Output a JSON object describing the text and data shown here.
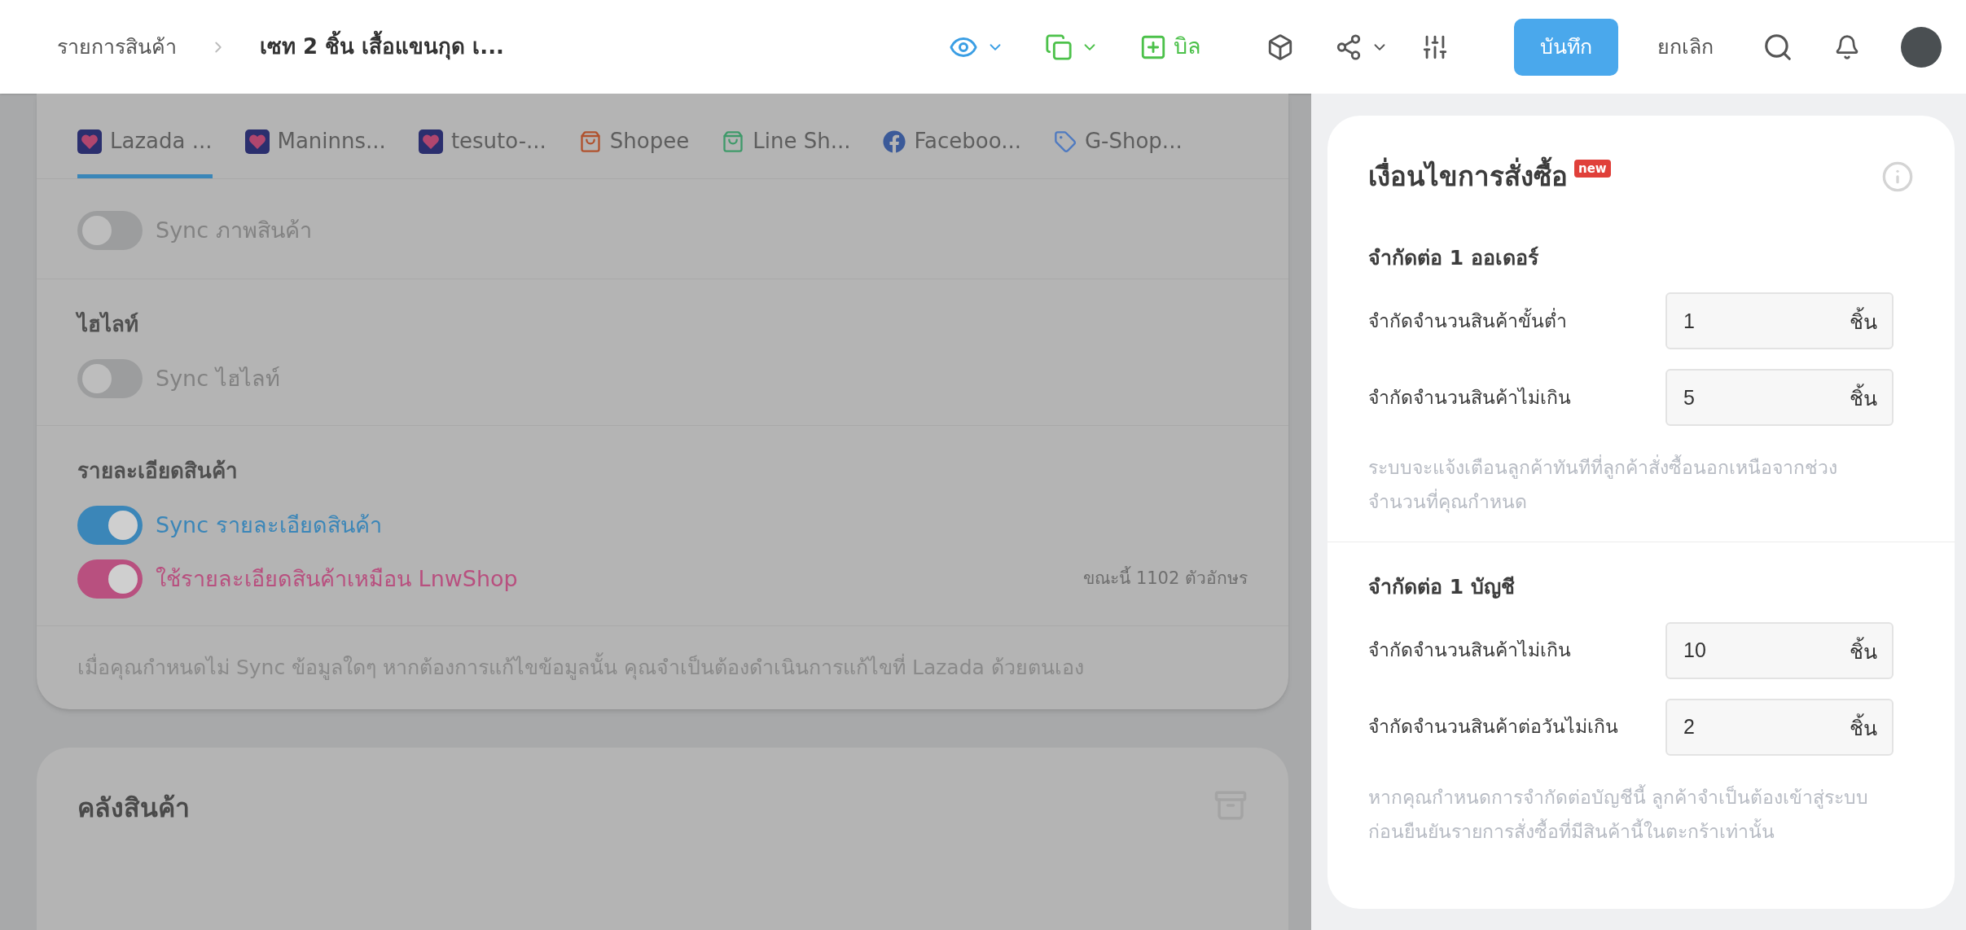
{
  "breadcrumb": {
    "parent": "รายการสินค้า",
    "current": "เซท 2 ชิ้น เสื้อแขนกุด เ..."
  },
  "toolbar": {
    "bill_label": "บิล",
    "save": "บันทึก",
    "cancel": "ยกเลิก"
  },
  "channel_tabs": [
    {
      "kind": "lazada",
      "label": "Lazada ...",
      "selected": true
    },
    {
      "kind": "lazada",
      "label": "Maninns...",
      "selected": false
    },
    {
      "kind": "lazada",
      "label": "tesuto-...",
      "selected": false
    },
    {
      "kind": "shopee",
      "label": "Shopee",
      "selected": false
    },
    {
      "kind": "line",
      "label": "Line Sh...",
      "selected": false
    },
    {
      "kind": "facebook",
      "label": "Faceboo...",
      "selected": false
    },
    {
      "kind": "gshop",
      "label": "G-Shop...",
      "selected": false
    }
  ],
  "sync_sections": [
    {
      "toggles": [
        {
          "label": "Sync ภาพสินค้า",
          "on": false
        }
      ]
    },
    {
      "heading": "ไฮไลท์",
      "toggles": [
        {
          "label": "Sync ไฮไลท์",
          "on": false
        }
      ]
    },
    {
      "heading": "รายละเอียดสินค้า",
      "toggles": [
        {
          "label": "Sync รายละเอียดสินค้า",
          "on": true,
          "color": "#3b86b8"
        },
        {
          "label": "ใช้รายละเอียดสินค้าเหมือน LnwShop",
          "on": true,
          "color": "#b8507f",
          "note": "ขณะนี้ 1102 ตัวอักษร"
        }
      ]
    }
  ],
  "sync_footnote": "เมื่อคุณกำหนดไม่ Sync ข้อมูลใดๆ หากต้องการแก้ไขข้อมูลนั้น คุณจำเป็นต้องดำเนินการแก้ไขที่ Lazada ด้วยตนเอง",
  "warehouse": {
    "title": "คลังสินค้า"
  },
  "order_conditions": {
    "title": "เงื่อนไขการสั่งซื้อ",
    "badge": "new",
    "groups": [
      {
        "heading": "จำกัดต่อ 1 ออเดอร์",
        "fields": [
          {
            "label": "จำกัดจำนวนสินค้าขั้นต่ำ",
            "value": "1",
            "unit": "ชิ้น"
          },
          {
            "label": "จำกัดจำนวนสินค้าไม่เกิน",
            "value": "5",
            "unit": "ชิ้น"
          }
        ],
        "note": "ระบบจะแจ้งเตือนลูกค้าทันทีที่ลูกค้าสั่งซื้อนอกเหนือจากช่วงจำนวนที่คุณกำหนด"
      },
      {
        "heading": "จำกัดต่อ 1 บัญชี",
        "fields": [
          {
            "label": "จำกัดจำนวนสินค้าไม่เกิน",
            "value": "10",
            "unit": "ชิ้น"
          },
          {
            "label": "จำกัดจำนวนสินค้าต่อวันไม่เกิน",
            "value": "2",
            "unit": "ชิ้น"
          }
        ],
        "note": "หากคุณกำหนดการจำกัดต่อบัญชีนี้ ลูกค้าจำเป็นต้องเข้าสู่ระบบก่อนยืนยันรายการสั่งซื้อที่มีสินค้านี้ในตะกร้าเท่านั้น"
      }
    ]
  }
}
